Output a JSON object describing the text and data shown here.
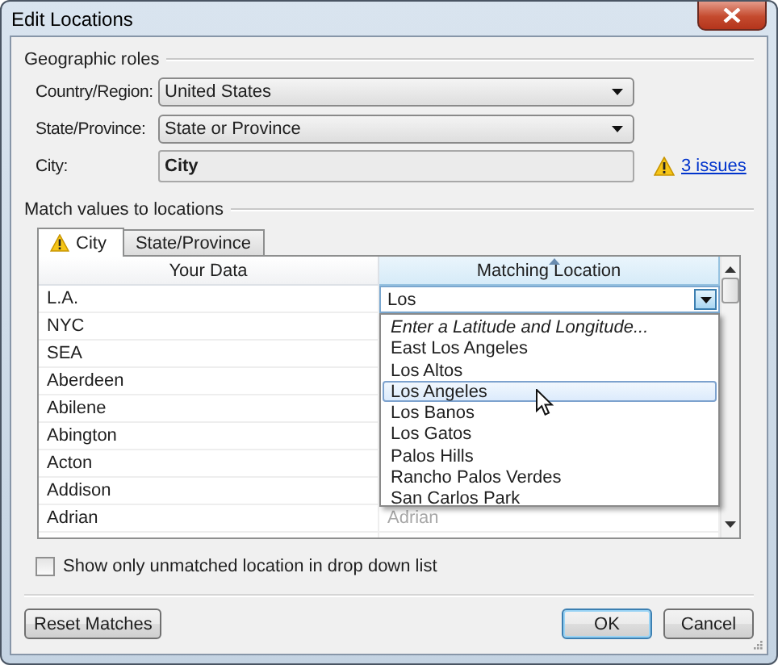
{
  "window": {
    "title": "Edit Locations"
  },
  "geographic_roles": {
    "heading": "Geographic roles",
    "fields": [
      {
        "label": "Country/Region:",
        "value": "United States",
        "kind": "combo"
      },
      {
        "label": "State/Province:",
        "value": "State or Province",
        "kind": "combo"
      },
      {
        "label": "City:",
        "value": "City",
        "kind": "readonly",
        "warning": "3 issues"
      }
    ]
  },
  "match": {
    "heading": "Match values to locations",
    "tabs": [
      {
        "label": "City",
        "selected": true,
        "warning": true
      },
      {
        "label": "State/Province",
        "selected": false,
        "warning": false
      }
    ],
    "columns": [
      {
        "label": "Your Data",
        "sorted": false
      },
      {
        "label": "Matching Location",
        "sorted": true
      }
    ],
    "rows": [
      {
        "your_data": "L.A.",
        "kind": "editing",
        "matching": "Los"
      },
      {
        "your_data": "NYC",
        "kind": "plain"
      },
      {
        "your_data": "SEA",
        "kind": "plain"
      },
      {
        "your_data": "Aberdeen",
        "kind": "plain"
      },
      {
        "your_data": "Abilene",
        "kind": "plain"
      },
      {
        "your_data": "Abington",
        "kind": "plain"
      },
      {
        "your_data": "Acton",
        "kind": "plain"
      },
      {
        "your_data": "Addison",
        "kind": "plain"
      },
      {
        "your_data": "Adrian",
        "kind": "suggested",
        "matching": "Adrian"
      }
    ],
    "dropdown": [
      {
        "label": "Enter a Latitude and Longitude...",
        "kind": "prompt",
        "selected": false
      },
      {
        "label": "East Los Angeles",
        "kind": "option",
        "selected": false
      },
      {
        "label": "Los Altos",
        "kind": "option",
        "selected": false
      },
      {
        "label": "Los Angeles",
        "kind": "option",
        "selected": true
      },
      {
        "label": "Los Banos",
        "kind": "option",
        "selected": false
      },
      {
        "label": "Los Gatos",
        "kind": "option",
        "selected": false
      },
      {
        "label": "Palos Hills",
        "kind": "option",
        "selected": false
      },
      {
        "label": "Rancho Palos Verdes",
        "kind": "option",
        "selected": false
      },
      {
        "label": "San Carlos Park",
        "kind": "option",
        "selected": false
      }
    ],
    "unmatched_only": {
      "label": "Show only unmatched location in drop down list",
      "checked": false
    }
  },
  "buttons": [
    {
      "label": "Reset Matches",
      "kind": "left",
      "default": false
    },
    {
      "label": "OK",
      "kind": "right",
      "default": true
    },
    {
      "label": "Cancel",
      "kind": "right",
      "default": false
    }
  ]
}
